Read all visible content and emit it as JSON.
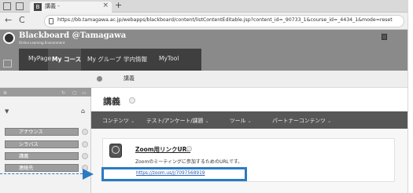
{
  "browser": {
    "tab_title": "講義 -",
    "tab_close": "×",
    "tab_new": "+",
    "nav_back": "←",
    "nav_reload": "C",
    "url": "https://bb.tamagawa.ac.jp/webapps/blackboard/content/listContentEditable.jsp?content_id=_90733_1&course_id=_4434_1&mode=reset"
  },
  "header": {
    "logo_text": "Blackboard @Tamagawa",
    "logo_sub": "Online Learning Environment",
    "nav": [
      "MyPage",
      "My コース",
      "My グループ",
      "学内情報",
      "MyTool"
    ]
  },
  "breadcrumb": {
    "current": "講義"
  },
  "sidebar": {
    "items": [
      {
        "label": "アナウンス"
      },
      {
        "label": "シラバス"
      },
      {
        "label": "講義"
      },
      {
        "label": "連絡先"
      }
    ]
  },
  "main": {
    "title": "講義",
    "menu": [
      {
        "label": "コンテンツ"
      },
      {
        "label": "テスト/アンケート/課題"
      },
      {
        "label": "ツール"
      },
      {
        "label": "パートナーコンテンツ"
      }
    ],
    "item": {
      "title": "Zoom用リンクURL",
      "description": "Zoomのミーティングに参加するためのURLです。",
      "link": "https://zoom.us/j/7097568919"
    }
  },
  "colors": {
    "accent": "#2a7bc2",
    "navbar": "#3f3f3f",
    "menubar": "#575757"
  }
}
